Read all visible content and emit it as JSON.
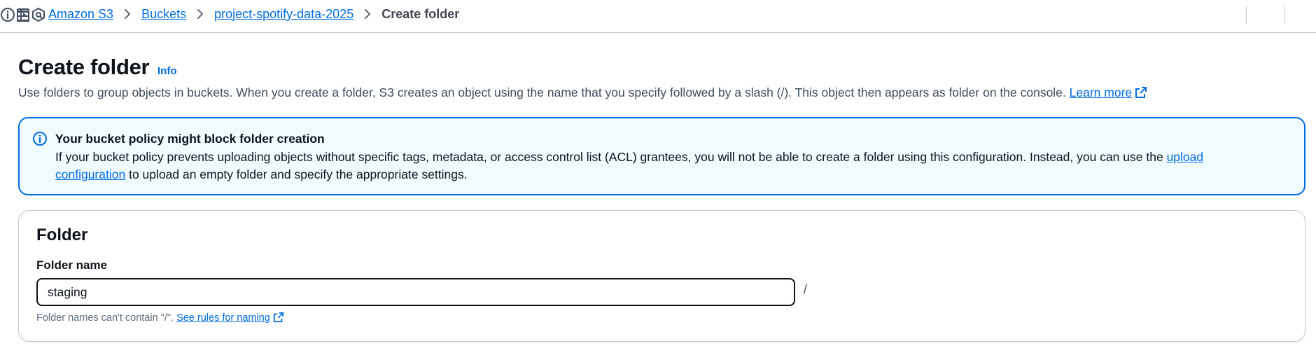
{
  "breadcrumb": {
    "items": [
      "Amazon S3",
      "Buckets",
      "project-spotify-data-2025"
    ],
    "current": "Create folder"
  },
  "header": {
    "title": "Create folder",
    "info_label": "Info",
    "description": "Use folders to group objects in buckets. When you create a folder, S3 creates an object using the name that you specify followed by a slash (/). This object then appears as folder on the console.",
    "learn_more_label": "Learn more"
  },
  "alert": {
    "title": "Your bucket policy might block folder creation",
    "body_prefix": "If your bucket policy prevents uploading objects without specific tags, metadata, or access control list (ACL) grantees, you will not be able to create a folder using this configuration. Instead, you can use the",
    "link_label": "upload configuration",
    "body_suffix": "to upload an empty folder and specify the appropriate settings."
  },
  "folder": {
    "section_title": "Folder",
    "name_label": "Folder name",
    "name_value": "staging",
    "suffix": "/",
    "hint_prefix": "Folder names can't contain \"/\".",
    "hint_link": "See rules for naming"
  },
  "icons": {
    "menu": "hamburger-menu-icon",
    "breadcrumb_separator": "chevron-right-icon",
    "info": "info-circle-icon",
    "panel": "side-panel-icon",
    "assistant": "hexagon-assistant-icon",
    "external": "external-link-icon",
    "alert": "info-circle-icon"
  },
  "colors": {
    "link": "#006ce0",
    "alert_border": "#006ce0",
    "alert_background": "#f0fbff",
    "text": "#0f141a",
    "muted": "#5f6b7a"
  }
}
